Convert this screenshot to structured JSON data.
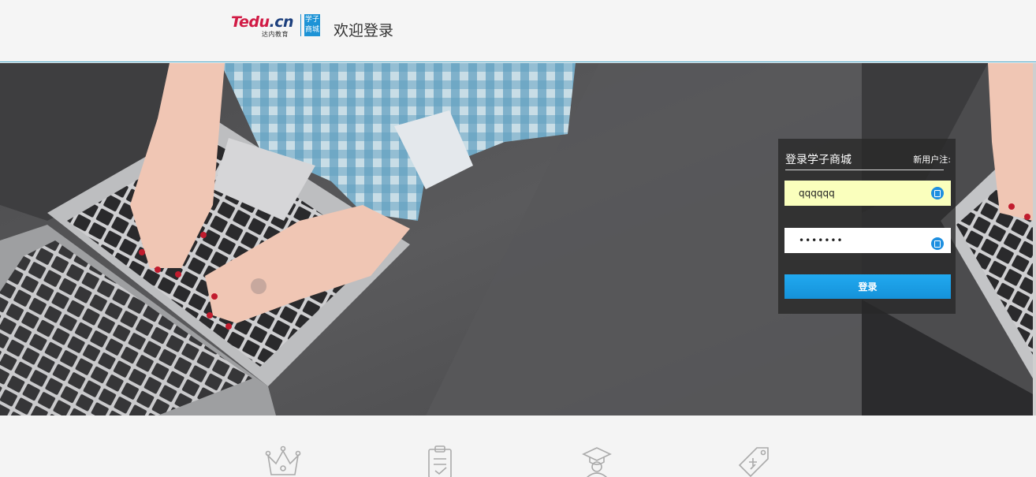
{
  "header": {
    "logo_text_main": "Tedu",
    "logo_text_cn": ".cn",
    "logo_subtitle": "达内教育",
    "logo_badge_line1": "学子",
    "logo_badge_line2": "商城",
    "title": "欢迎登录"
  },
  "login": {
    "title": "登录学子商城",
    "register_link": "新用户注:",
    "username_value": "qqqqqq",
    "password_value": "qqqqqqq",
    "submit_label": "登录"
  },
  "features": {
    "icons": [
      "crown-icon",
      "clipboard-check-icon",
      "graduate-icon",
      "price-tag-icon"
    ]
  },
  "colors": {
    "accent": "#1d93d6",
    "button": "#1ea4ec",
    "autofill": "#faffbd",
    "panel": "#282828"
  }
}
